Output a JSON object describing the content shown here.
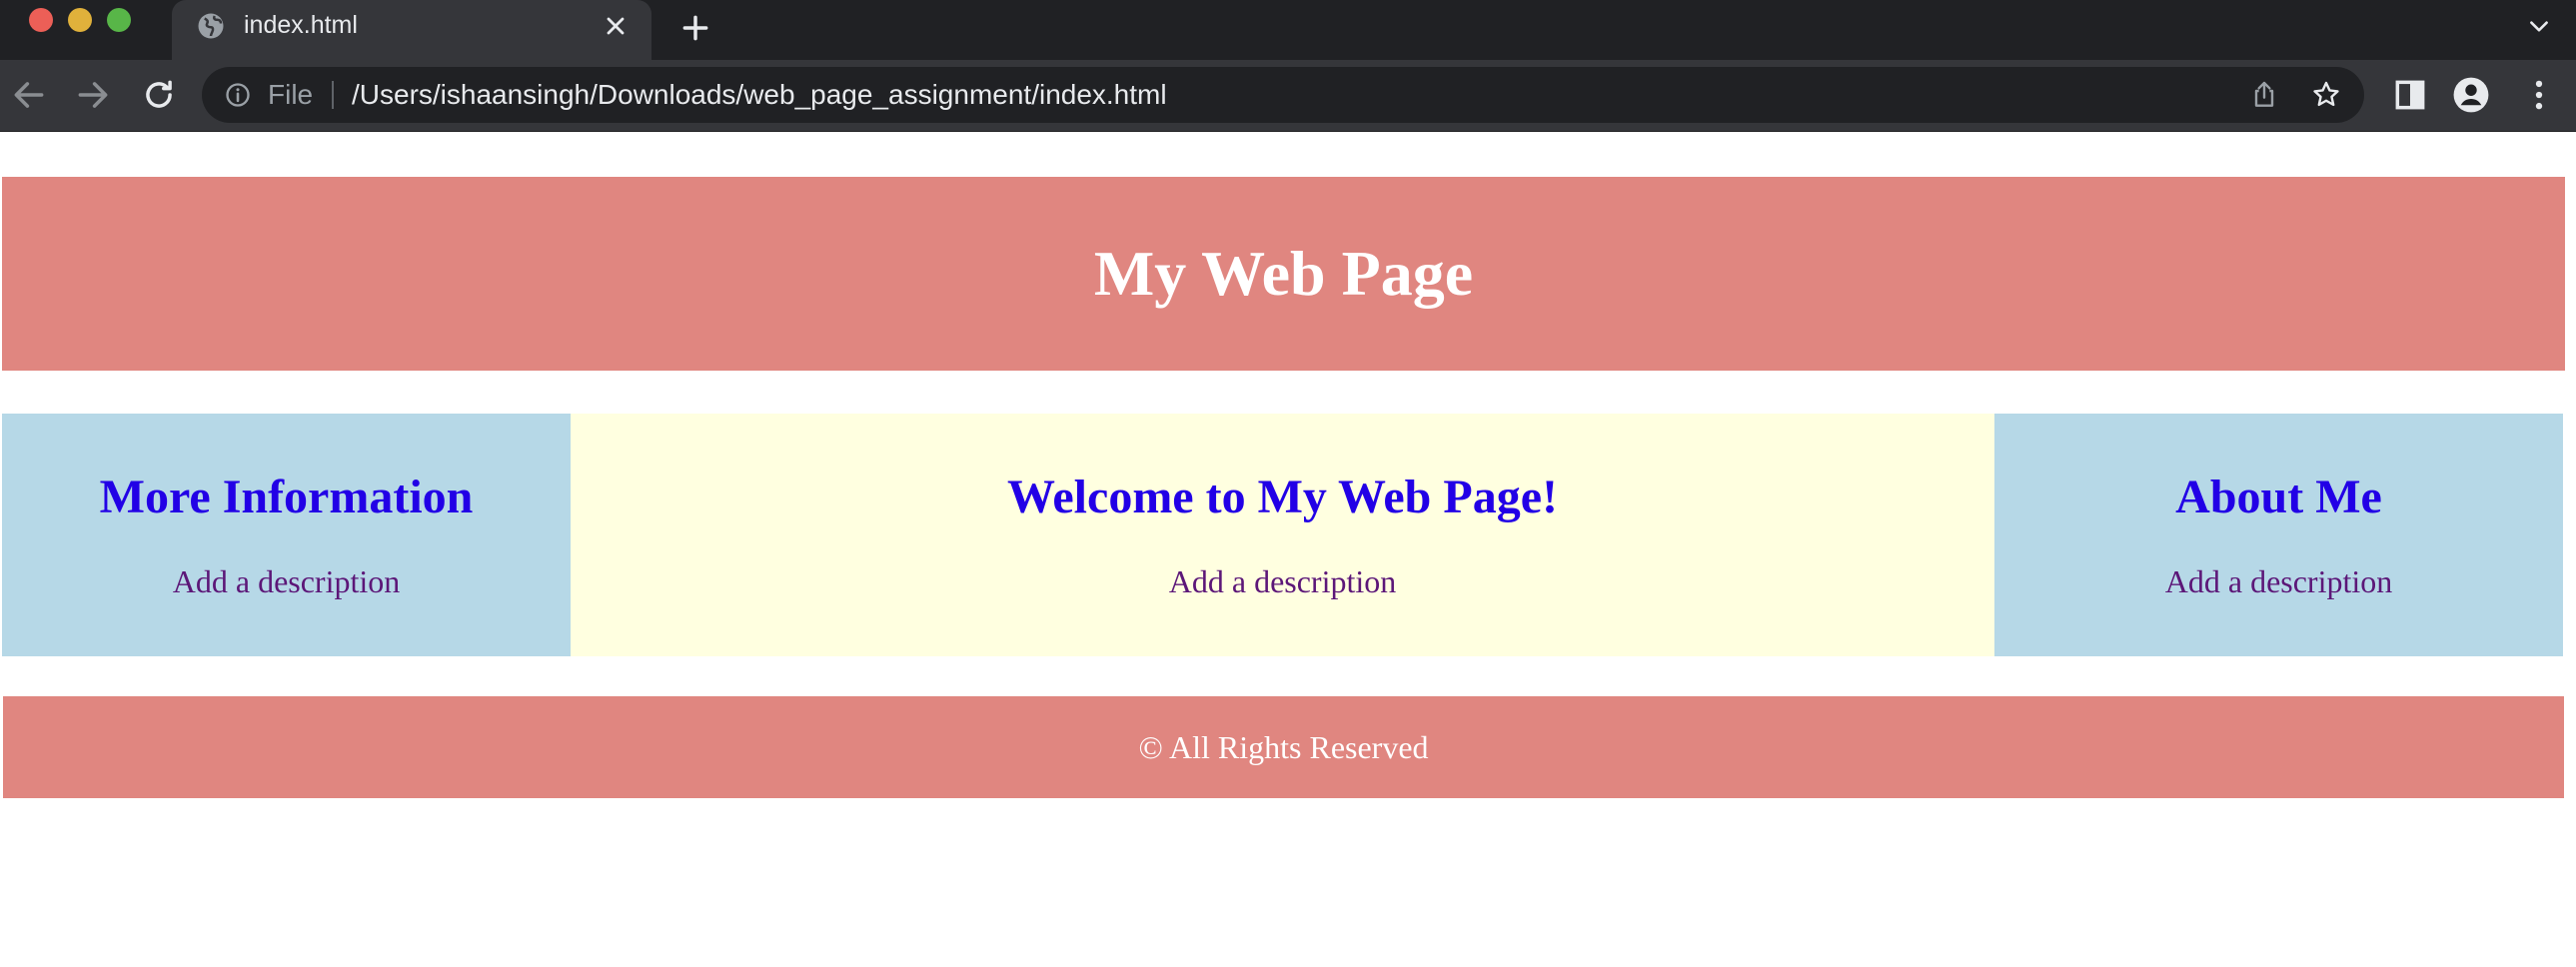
{
  "browser": {
    "tab": {
      "title": "index.html",
      "icon": "globe-icon"
    },
    "address_bar": {
      "scheme_label": "File",
      "url": "/Users/ishaansingh/Downloads/web_page_assignment/index.html"
    },
    "icons": [
      "back-arrow-icon",
      "forward-arrow-icon",
      "reload-icon",
      "info-icon",
      "share-icon",
      "star-icon",
      "side-panel-icon",
      "profile-icon",
      "kebab-menu-icon",
      "close-icon",
      "plus-icon",
      "chevron-down-icon"
    ]
  },
  "page": {
    "header": {
      "title": "My Web Page"
    },
    "columns": [
      {
        "heading": "More Information",
        "description": "Add a description"
      },
      {
        "heading": "Welcome to My Web Page!",
        "description": "Add a description"
      },
      {
        "heading": "About Me",
        "description": "Add a description"
      }
    ],
    "footer": {
      "text": "© All Rights Reserved"
    }
  },
  "colors": {
    "header_footer_bg": "#e08680",
    "side_column_bg": "#b6d8e7",
    "middle_column_bg": "#ffffe0",
    "heading_color": "#2200e6",
    "description_color": "#5c1778"
  }
}
